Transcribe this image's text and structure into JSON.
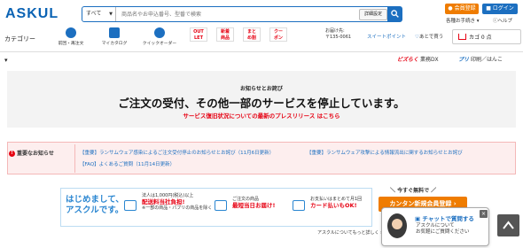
{
  "header": {
    "logo": "ASKUL",
    "search": {
      "category": "すべて",
      "placeholder": "商品名やお申込番号、型番で検索",
      "detail_label": "詳細設定"
    },
    "register_label": "会員登録",
    "login_label": "ログイン",
    "util_links": [
      "各種お手続き",
      "ヘルプ"
    ]
  },
  "nav": {
    "category_label": "カテゴリー",
    "items": [
      {
        "label": "前回・再注文"
      },
      {
        "label": "マイカタログ"
      },
      {
        "label": "クイックオーダー"
      }
    ],
    "badges": [
      {
        "top": "OUT",
        "bottom": "LET"
      },
      {
        "top": "新着",
        "bottom": "商品"
      },
      {
        "top": "まと",
        "bottom": "め割"
      },
      {
        "top": "クー",
        "bottom": "ポン"
      }
    ],
    "delivery_label": "お届け先:",
    "delivery_zip": "〒135-0061",
    "suite_point": "スイートポイント",
    "favorites": "あとで買う",
    "cart_label": "カゴ 0 点"
  },
  "subheader": {
    "dx_logo": "ビズらく",
    "dx_text": "業務DX",
    "print_logo": "プリ",
    "print_text": "印刷／はんこ"
  },
  "notice": {
    "subtitle": "お知らせとお詫び",
    "title": "ご注文の受付、その他一部のサービスを停止しています。",
    "link_text": "サービス復旧状況についての最新のプレスリリース",
    "link_more": "はこちら"
  },
  "important": {
    "label": "重要なお知らせ",
    "links": [
      "【重要】ランサムウェア感染によるご注文受付停止のお知らせとお詫び（11月6日更新）",
      "【重要】ランサムウェア攻撃による情報流出に関するお知らせとお詫び",
      "【FAQ】よくあるご質問（11月14日更新）"
    ]
  },
  "banner": {
    "hello_line1": "はじめまして、",
    "hello_line2": "アスクルです。",
    "item1_line1": "法人は1,000円(税込)以上",
    "item1_line2": "配送料当社負担!",
    "item1_line3": "※一部の商品・パブリの商品を除く",
    "item2_line1": "ご注文の商品",
    "item2_line2": "最短当日お届け!",
    "item3_line1": "お支払いはまとめて月1回",
    "item3_line2": "カード払いもOK!",
    "free_caption": "＼ 今すぐ無料で ／",
    "register_button": "カンタン新規会員登録",
    "about_link": "アスクルについてもっと詳しく"
  },
  "chat": {
    "title": "チャットで質問する",
    "body_line1": "アスクルについて",
    "body_line2": "お気軽にご質問ください",
    "close": "×"
  }
}
